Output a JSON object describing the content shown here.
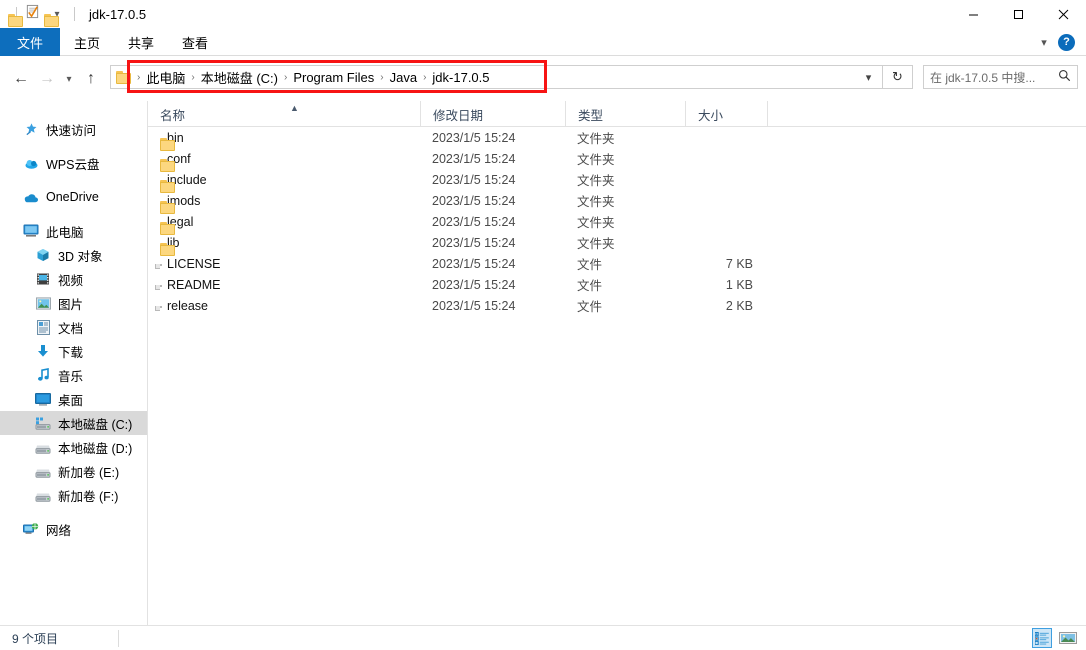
{
  "window": {
    "title": "jdk-17.0.5",
    "quick_access_icons": [
      "folder-icon",
      "properties-checkmark-icon",
      "new-folder-icon",
      "customize-dropdown-icon"
    ],
    "controls": {
      "minimize": "–",
      "maximize": "☐",
      "close": "✕"
    }
  },
  "ribbon": {
    "tabs": [
      {
        "label": "文件",
        "name": "tab-file",
        "active": true
      },
      {
        "label": "主页",
        "name": "tab-home",
        "active": false
      },
      {
        "label": "共享",
        "name": "tab-share",
        "active": false
      },
      {
        "label": "查看",
        "name": "tab-view",
        "active": false
      }
    ],
    "collapse_icon": "chevron-down-icon",
    "help_label": "?"
  },
  "navigation": {
    "back": "←",
    "forward": "→",
    "recent": "˅",
    "up": "↑"
  },
  "address": {
    "crumbs": [
      "此电脑",
      "本地磁盘 (C:)",
      "Program Files",
      "Java",
      "jdk-17.0.5"
    ],
    "separator": "›",
    "dropdown_icon": "chevron-down-icon",
    "refresh_icon": "↻",
    "highlight_color": "#f71414"
  },
  "search": {
    "placeholder": "在 jdk-17.0.5 中搜...",
    "icon": "search-icon"
  },
  "sidebar": {
    "items": [
      {
        "label": "快速访问",
        "icon": "pin-star-icon",
        "indent": 0,
        "selected": false,
        "gap_after": true
      },
      {
        "label": "WPS云盘",
        "icon": "cloud-icon",
        "indent": 0,
        "selected": false,
        "gap_after": true
      },
      {
        "label": "OneDrive",
        "icon": "onedrive-cloud-icon",
        "indent": 0,
        "selected": false,
        "gap_after": true
      },
      {
        "label": "此电脑",
        "icon": "this-pc-icon",
        "indent": 0,
        "selected": false,
        "gap_after": false
      },
      {
        "label": "3D 对象",
        "icon": "3d-objects-icon",
        "indent": 1,
        "selected": false,
        "gap_after": false
      },
      {
        "label": "视频",
        "icon": "videos-icon",
        "indent": 1,
        "selected": false,
        "gap_after": false
      },
      {
        "label": "图片",
        "icon": "pictures-icon",
        "indent": 1,
        "selected": false,
        "gap_after": false
      },
      {
        "label": "文档",
        "icon": "documents-icon",
        "indent": 1,
        "selected": false,
        "gap_after": false
      },
      {
        "label": "下载",
        "icon": "downloads-icon",
        "indent": 1,
        "selected": false,
        "gap_after": false
      },
      {
        "label": "音乐",
        "icon": "music-icon",
        "indent": 1,
        "selected": false,
        "gap_after": false
      },
      {
        "label": "桌面",
        "icon": "desktop-icon",
        "indent": 1,
        "selected": false,
        "gap_after": false
      },
      {
        "label": "本地磁盘 (C:)",
        "icon": "system-drive-icon",
        "indent": 1,
        "selected": true,
        "gap_after": false
      },
      {
        "label": "本地磁盘 (D:)",
        "icon": "drive-icon",
        "indent": 1,
        "selected": false,
        "gap_after": false
      },
      {
        "label": "新加卷 (E:)",
        "icon": "drive-icon",
        "indent": 1,
        "selected": false,
        "gap_after": false
      },
      {
        "label": "新加卷 (F:)",
        "icon": "drive-icon",
        "indent": 1,
        "selected": false,
        "gap_after": true
      },
      {
        "label": "网络",
        "icon": "network-icon",
        "indent": 0,
        "selected": false,
        "gap_after": false
      }
    ]
  },
  "columns": [
    {
      "label": "名称",
      "name": "column-header-name",
      "sorted": "asc"
    },
    {
      "label": "修改日期",
      "name": "column-header-date-modified",
      "sorted": ""
    },
    {
      "label": "类型",
      "name": "column-header-type",
      "sorted": ""
    },
    {
      "label": "大小",
      "name": "column-header-size",
      "sorted": ""
    }
  ],
  "files": [
    {
      "name": "bin",
      "date": "2023/1/5 15:24",
      "type": "文件夹",
      "size": "",
      "icon": "folder-icon"
    },
    {
      "name": "conf",
      "date": "2023/1/5 15:24",
      "type": "文件夹",
      "size": "",
      "icon": "folder-icon"
    },
    {
      "name": "include",
      "date": "2023/1/5 15:24",
      "type": "文件夹",
      "size": "",
      "icon": "folder-icon"
    },
    {
      "name": "jmods",
      "date": "2023/1/5 15:24",
      "type": "文件夹",
      "size": "",
      "icon": "folder-icon"
    },
    {
      "name": "legal",
      "date": "2023/1/5 15:24",
      "type": "文件夹",
      "size": "",
      "icon": "folder-icon"
    },
    {
      "name": "lib",
      "date": "2023/1/5 15:24",
      "type": "文件夹",
      "size": "",
      "icon": "folder-icon"
    },
    {
      "name": "LICENSE",
      "date": "2023/1/5 15:24",
      "type": "文件",
      "size": "7 KB",
      "icon": "file-icon"
    },
    {
      "name": "README",
      "date": "2023/1/5 15:24",
      "type": "文件",
      "size": "1 KB",
      "icon": "file-icon"
    },
    {
      "name": "release",
      "date": "2023/1/5 15:24",
      "type": "文件",
      "size": "2 KB",
      "icon": "file-icon"
    }
  ],
  "statusbar": {
    "item_count": "9 个项目",
    "views": [
      {
        "name": "details-view-button",
        "active": true
      },
      {
        "name": "large-icons-view-button",
        "active": false
      }
    ]
  }
}
